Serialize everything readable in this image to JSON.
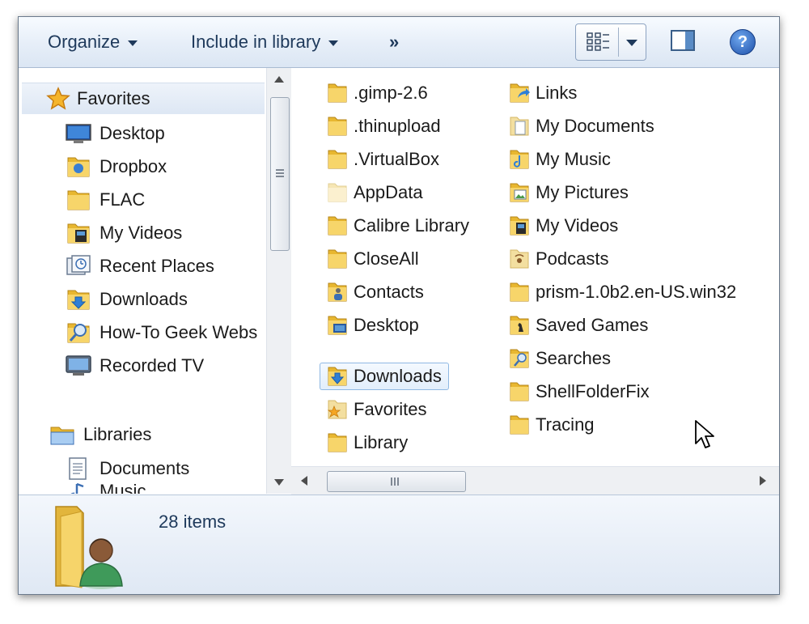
{
  "toolbar": {
    "organize_label": "Organize",
    "include_label": "Include in library",
    "more_label": "»",
    "help_label": "?"
  },
  "navigation": {
    "favorites_label": "Favorites",
    "favorites": [
      {
        "label": "Desktop",
        "icon": "desktop-icon"
      },
      {
        "label": "Dropbox",
        "icon": "dropbox-folder-icon"
      },
      {
        "label": "FLAC",
        "icon": "folder-icon"
      },
      {
        "label": "My Videos",
        "icon": "videos-folder-icon"
      },
      {
        "label": "Recent Places",
        "icon": "recent-places-icon"
      },
      {
        "label": "Downloads",
        "icon": "downloads-folder-icon"
      },
      {
        "label": "How-To Geek Webs",
        "icon": "search-folder-icon"
      },
      {
        "label": "Recorded TV",
        "icon": "tv-icon"
      }
    ],
    "libraries_label": "Libraries",
    "libraries": [
      {
        "label": "Documents",
        "icon": "document-icon"
      },
      {
        "label": "Music",
        "icon": "music-icon"
      }
    ]
  },
  "files": {
    "column1": [
      {
        "name": ".gimp-2.6",
        "icon": "folder-icon"
      },
      {
        "name": ".thinupload",
        "icon": "folder-icon"
      },
      {
        "name": ".VirtualBox",
        "icon": "folder-icon"
      },
      {
        "name": "AppData",
        "icon": "hidden-folder-icon"
      },
      {
        "name": "Calibre Library",
        "icon": "folder-icon"
      },
      {
        "name": "CloseAll",
        "icon": "folder-icon"
      },
      {
        "name": "Contacts",
        "icon": "contacts-folder-icon"
      },
      {
        "name": "Desktop",
        "icon": "desktop-folder-icon"
      },
      {
        "name": "Downloads",
        "icon": "downloads-folder-icon"
      },
      {
        "name": "Favorites",
        "icon": "favorites-folder-icon"
      },
      {
        "name": "Library",
        "icon": "folder-icon"
      }
    ],
    "column2": [
      {
        "name": "Links",
        "icon": "links-folder-icon"
      },
      {
        "name": "My Documents",
        "icon": "documents-folder-icon"
      },
      {
        "name": "My Music",
        "icon": "music-folder-icon"
      },
      {
        "name": "My Pictures",
        "icon": "pictures-folder-icon"
      },
      {
        "name": "My Videos",
        "icon": "videos-folder-icon"
      },
      {
        "name": "Podcasts",
        "icon": "podcasts-folder-icon"
      },
      {
        "name": "prism-1.0b2.en-US.win32",
        "icon": "folder-icon"
      },
      {
        "name": "Saved Games",
        "icon": "saved-games-folder-icon"
      },
      {
        "name": "Searches",
        "icon": "searches-folder-icon"
      },
      {
        "name": "ShellFolderFix",
        "icon": "folder-icon"
      },
      {
        "name": "Tracing",
        "icon": "folder-icon"
      }
    ],
    "selected": "Downloads"
  },
  "details": {
    "item_count": "28 items",
    "icon": "user-folder-icon"
  },
  "colors": {
    "toolbar_text": "#1e395b",
    "folder_yellow": "#f2c94c",
    "selection_border": "#8fb8e3"
  }
}
